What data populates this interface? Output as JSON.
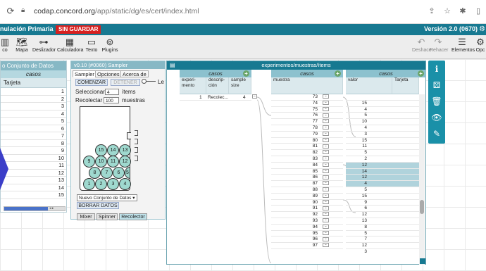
{
  "browser": {
    "url_host": "codap.concord.org",
    "url_path": "/app/static/dg/es/cert/index.html",
    "icons": [
      "reload-icon",
      "lock-icon",
      "share-icon",
      "star-icon",
      "extension-icon",
      "sidebar-icon"
    ]
  },
  "topbar": {
    "title": "nulación Primaria",
    "unsaved_badge": "SIN GUARDAR",
    "version": "Versión 2.0 (0670)"
  },
  "toolshelf": {
    "left_tools": [
      {
        "label": "co",
        "icon": "chart-icon"
      },
      {
        "label": "Mapa",
        "icon": "map-icon"
      },
      {
        "label": "Deslizador",
        "icon": "slider-icon"
      },
      {
        "label": "Calculadora",
        "icon": "calculator-icon"
      },
      {
        "label": "Texto",
        "icon": "text-icon"
      },
      {
        "label": "Plugins",
        "icon": "plugin-icon"
      }
    ],
    "right_tools": [
      {
        "label": "Deshace",
        "icon": "undo-icon"
      },
      {
        "label": "Rehacer",
        "icon": "redo-icon"
      },
      {
        "label": "Elementos",
        "icon": "list-icon"
      },
      {
        "label": "Opc",
        "icon": "gear-icon"
      }
    ]
  },
  "left_table": {
    "title": "o Conjunto de Datos",
    "case_header": "casos",
    "column": "Tarjeta",
    "rows": [
      "1",
      "2",
      "3",
      "4",
      "5",
      "6",
      "7",
      "8",
      "9",
      "10",
      "11",
      "12",
      "13",
      "14",
      "15"
    ]
  },
  "sampler": {
    "title": "v0.10 (#0060)   Sampler",
    "tabs": [
      "Sampler",
      "Opciones",
      "Acerca de"
    ],
    "start_button": "COMENZAR",
    "stop_button": "DETENER",
    "speed_label": "Le",
    "select_label": "Seleccionar",
    "select_value": "4",
    "items_label": "ítems",
    "collect_label": "Recolectar",
    "collect_value": "100",
    "samples_label": "muestras",
    "balls": [
      "15",
      "14",
      "13",
      "9",
      "10",
      "11",
      "12",
      "8",
      "7",
      "6",
      "5",
      "1",
      "2",
      "3",
      "4"
    ],
    "dataset_select": "Nuevo Conjunto de Datos",
    "clear_button": "BORRAR DATOS",
    "device_tabs": [
      "Mixer",
      "Spinner",
      "Recolector"
    ],
    "active_device": "Recolector"
  },
  "experiments": {
    "title": "experimentos/muestras/ítems",
    "case_header": "casos",
    "col1_headers": [
      "experi-\nmento",
      "descrip-\nción",
      "sample\nsize"
    ],
    "col1_row": {
      "experimento": "1",
      "descripcion": "Recolec...",
      "sample_size": "4"
    },
    "col2_header": "muestra",
    "muestra_rows": [
      "73",
      "74",
      "75",
      "76",
      "77",
      "78",
      "79",
      "80",
      "81",
      "82",
      "83",
      "84",
      "85",
      "86",
      "87",
      "88",
      "89",
      "90",
      "91",
      "92",
      "93",
      "94",
      "95",
      "96",
      "97"
    ],
    "col3_headers": [
      "valor",
      "Tarjeta"
    ],
    "valor_rows": [
      "15",
      "4",
      "5",
      "10",
      "4",
      "3",
      "15",
      "11",
      "5",
      "2",
      "12",
      "14",
      "12",
      "4",
      "5",
      "15",
      "9",
      "6",
      "12",
      "13",
      "8",
      "5",
      "7",
      "12",
      "3"
    ],
    "selected_rows": [
      11,
      12,
      13,
      14
    ]
  },
  "right_tools": [
    "info-icon",
    "dice-icon",
    "trash-icon",
    "eye-icon",
    "ruler-icon"
  ]
}
